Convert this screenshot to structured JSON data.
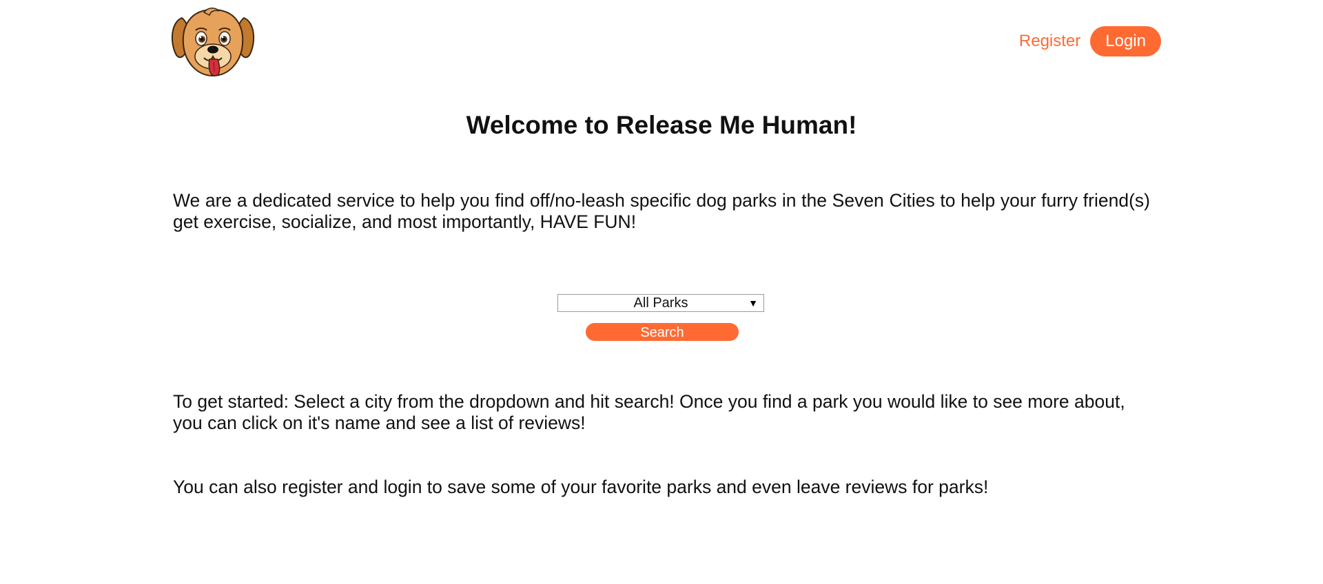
{
  "header": {
    "logo_icon": "dog-face-logo",
    "register_label": "Register",
    "login_label": "Login"
  },
  "main": {
    "title": "Welcome to Release Me Human!",
    "intro": "We are a dedicated service to help you find off/no-leash specific dog parks in the Seven Cities to help your furry friend(s) get exercise, socialize, and most importantly, HAVE FUN!",
    "city_select_value": "All Parks",
    "search_label": "Search",
    "getting_started": "To get started: Select a city from the dropdown and hit search! Once you find a park you would like to see more about, you can click on it's name and see a list of reviews!",
    "register_info": "You can also register and login to save some of your favorite parks and even leave reviews for parks!"
  },
  "colors": {
    "accent": "#ff6a33"
  }
}
